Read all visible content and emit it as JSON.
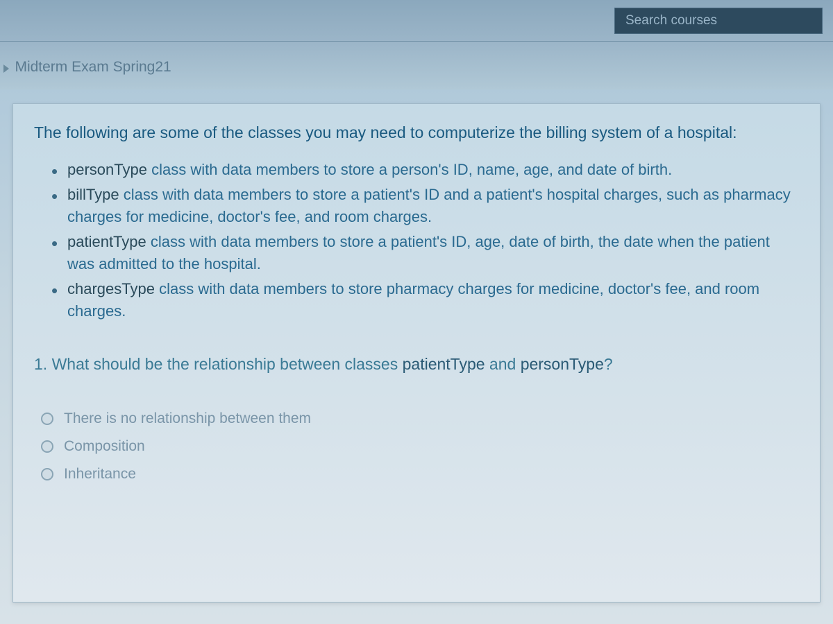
{
  "header": {
    "search_placeholder": "Search courses"
  },
  "breadcrumb": {
    "link_text": "Midterm Exam Spring21"
  },
  "content": {
    "intro": "The following are some of the classes you may need to computerize the billing system of a hospital:",
    "classes": [
      {
        "name": "personType",
        "desc": " class with data members to store a person's ID, name, age, and date of birth."
      },
      {
        "name": "billType",
        "desc": " class with data members to store a patient's ID and a patient's hospital charges, such as pharmacy charges for medicine, doctor's fee, and room charges."
      },
      {
        "name": "patientType",
        "desc": " class with data members to store a patient's ID, age, date of birth, the date when the patient was admitted to the hospital."
      },
      {
        "name": "chargesType",
        "desc": " class with data members to store pharmacy charges for medicine, doctor's fee, and room charges."
      }
    ],
    "question_prefix": "1. What should be the relationship between classes ",
    "question_term1": "patientType",
    "question_mid": " and ",
    "question_term2": "personType",
    "question_suffix": "?",
    "options": [
      "There is no relationship between them",
      "Composition",
      "Inheritance"
    ]
  }
}
